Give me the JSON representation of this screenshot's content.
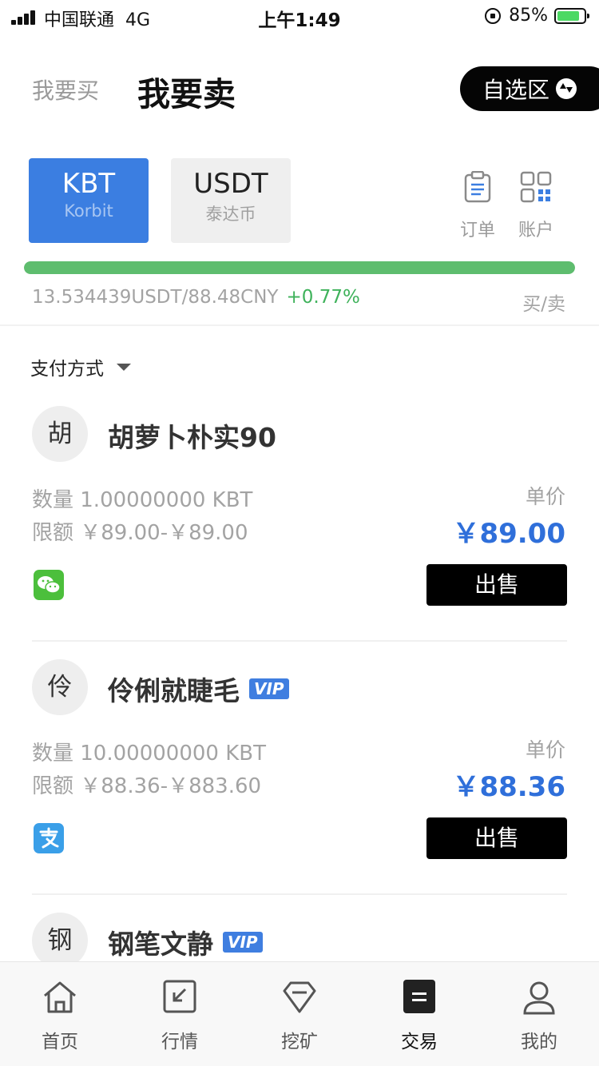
{
  "status_bar": {
    "carrier": "中国联通",
    "network": "4G",
    "time": "上午1:49",
    "battery": "85%"
  },
  "header": {
    "tab_buy": "我要买",
    "tab_sell": "我要卖",
    "watchlist_label": "自选区"
  },
  "coins": [
    {
      "symbol": "KBT",
      "name": "Korbit",
      "selected": true
    },
    {
      "symbol": "USDT",
      "name": "泰达币",
      "selected": false
    }
  ],
  "top_actions": {
    "orders": "订单",
    "account": "账户"
  },
  "market": {
    "progress": 1.0,
    "price_text": "13.534439USDT/88.48CNY",
    "change": "+0.77%",
    "buy_sell_link": "买/卖"
  },
  "filter": {
    "payment_label": "支付方式"
  },
  "listings": [
    {
      "avatar": "胡",
      "merchant": "胡萝卜朴实90",
      "vip": "",
      "quantity": "数量 1.00000000 KBT",
      "limit": "限额 ￥89.00-￥89.00",
      "unit_price_label": "单价",
      "price": "￥89.00",
      "payment": "wechat",
      "action": "出售"
    },
    {
      "avatar": "伶",
      "merchant": "伶俐就睫毛",
      "vip": "VIP",
      "quantity": "数量 10.00000000 KBT",
      "limit": "限额 ￥88.36-￥883.60",
      "unit_price_label": "单价",
      "price": "￥88.36",
      "payment": "alipay",
      "action": "出售"
    },
    {
      "avatar": "钢",
      "merchant": "钢笔文静",
      "vip": "VIP"
    }
  ],
  "bottom_nav": [
    {
      "label": "首页",
      "icon": "home-icon"
    },
    {
      "label": "行情",
      "icon": "market-icon"
    },
    {
      "label": "挖矿",
      "icon": "diamond-icon"
    },
    {
      "label": "交易",
      "icon": "trade-icon",
      "active": true
    },
    {
      "label": "我的",
      "icon": "user-icon"
    }
  ],
  "colors": {
    "accent": "#3b7ee1",
    "price": "#2f6fda",
    "positive": "#3fb25b",
    "progress": "#5ebd6e"
  }
}
